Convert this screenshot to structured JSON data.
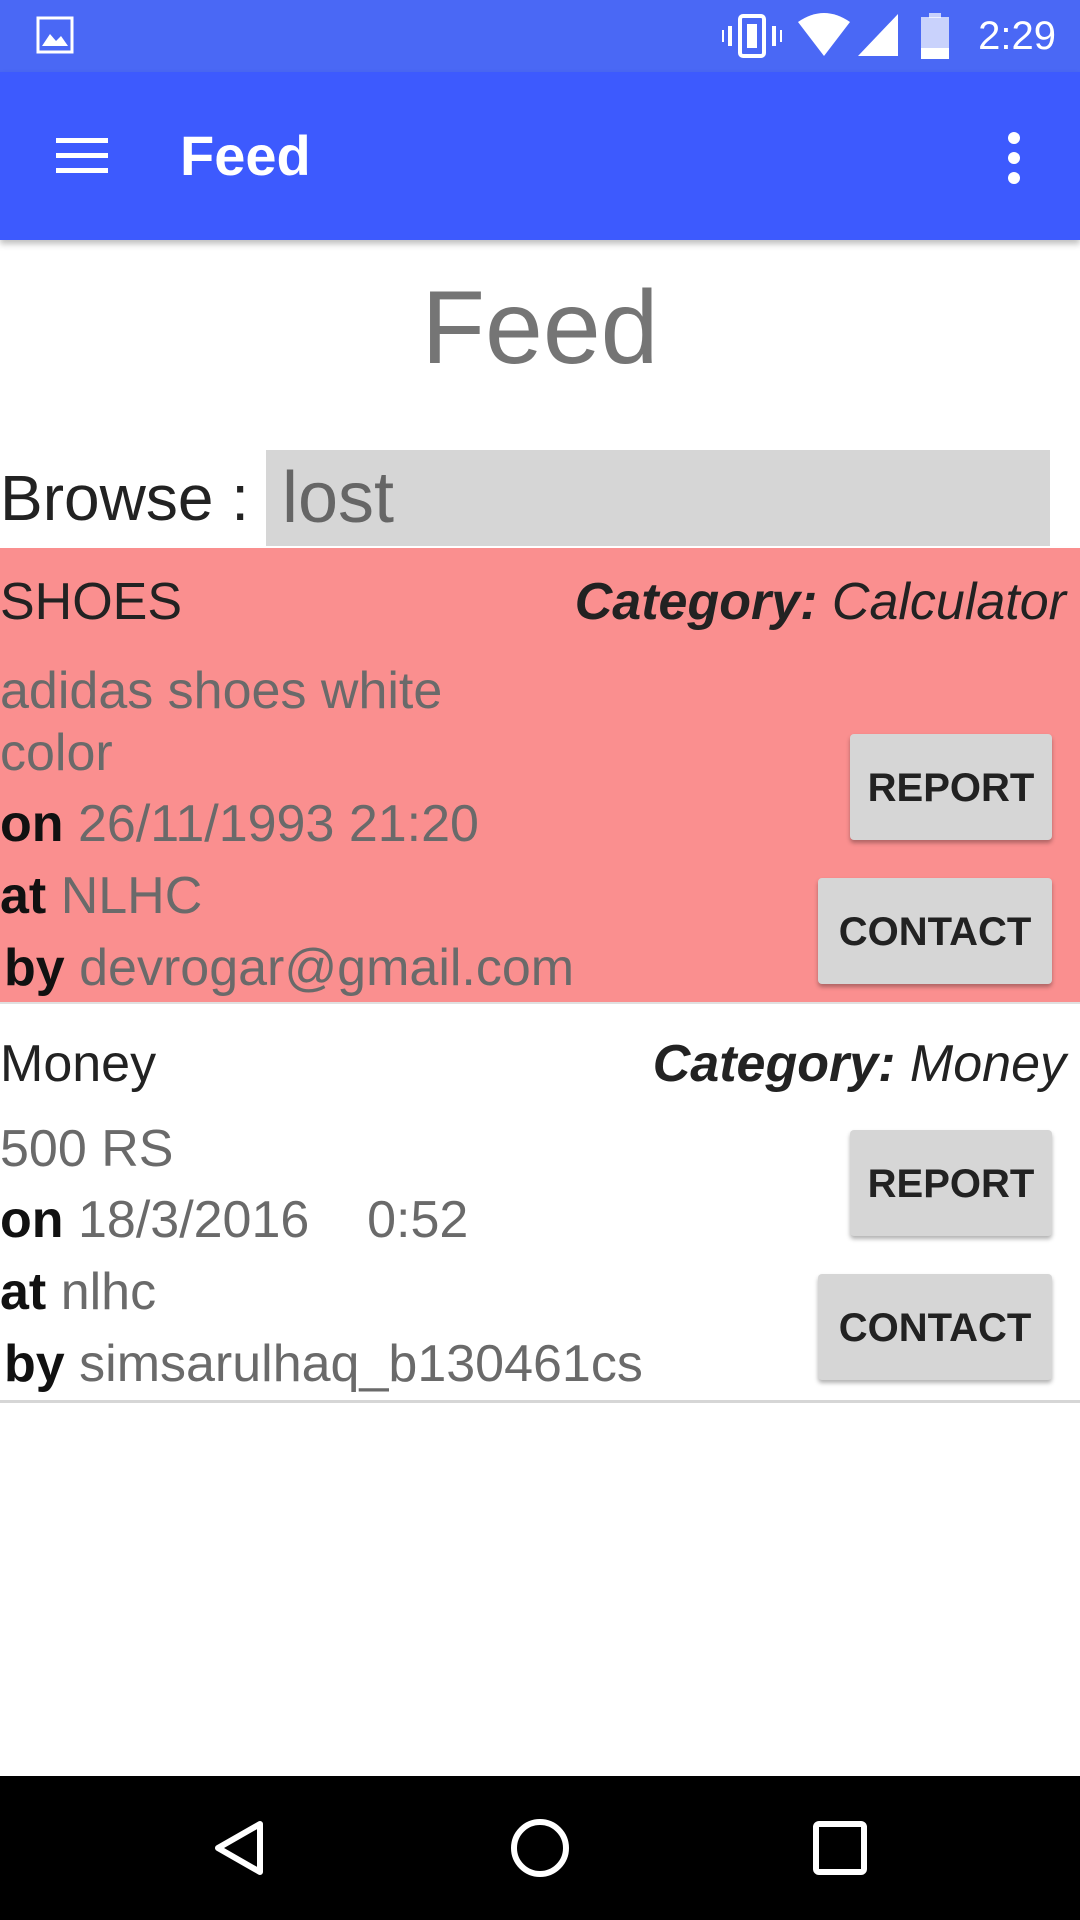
{
  "status_bar": {
    "time": "2:29",
    "icons": [
      "image-icon",
      "vibrate-icon",
      "wifi-icon",
      "signal-icon",
      "battery-icon"
    ]
  },
  "app_bar": {
    "title": "Feed",
    "icons": [
      "menu-icon",
      "more-vert-icon"
    ]
  },
  "page": {
    "title": "Feed",
    "browse_label": "Browse :",
    "browse_value": "lost"
  },
  "feed": [
    {
      "title": "SHOES",
      "category_label": "Category:",
      "category": "Calculator",
      "description": "adidas shoes white color",
      "on_label": "on",
      "on_value": "26/11/1993 21:20",
      "at_label": "at",
      "at_value": "NLHC",
      "by_label": "by",
      "by_value": "devrogar@gmail.com",
      "report_label": "REPORT",
      "contact_label": "CONTACT",
      "background": "#fa8f8f"
    },
    {
      "title": "Money",
      "category_label": "Category:",
      "category": "Money",
      "description": "500 RS",
      "on_label": "on",
      "on_value": "18/3/2016    0:52",
      "at_label": "at",
      "at_value": "nlhc",
      "by_label": "by",
      "by_value": "simsarulhaq_b130461cs",
      "report_label": "REPORT",
      "contact_label": "CONTACT",
      "background": "#ffffff"
    }
  ],
  "nav_bar": {
    "icons": [
      "back-icon",
      "home-icon",
      "recents-icon"
    ]
  },
  "colors": {
    "status_bar": "#4a68f5",
    "app_bar": "#3d5afe",
    "button": "#d6d6d6"
  }
}
